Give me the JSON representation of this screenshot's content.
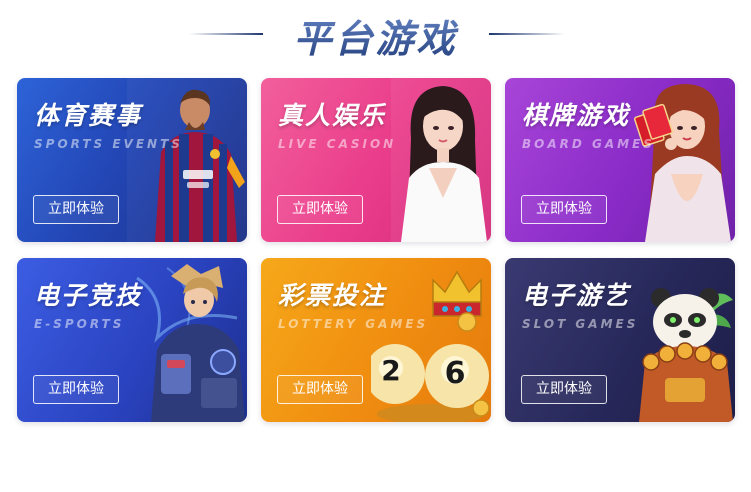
{
  "header": {
    "title": "平台游戏"
  },
  "cards": [
    {
      "title": "体育赛事",
      "subtitle": "SPORTS EVENTS",
      "button": "立即体验"
    },
    {
      "title": "真人娱乐",
      "subtitle": "LIVE CASION",
      "button": "立即体验"
    },
    {
      "title": "棋牌游戏",
      "subtitle": "BOARD GAMES",
      "button": "立即体验"
    },
    {
      "title": "电子竞技",
      "subtitle": "E-SPORTS",
      "button": "立即体验"
    },
    {
      "title": "彩票投注",
      "subtitle": "LOTTERY GAMES",
      "button": "立即体验"
    },
    {
      "title": "电子游艺",
      "subtitle": "SLOT GAMES",
      "button": "立即体验"
    }
  ],
  "lottery_balls": [
    "2",
    "6"
  ],
  "colors": {
    "header_title": "#2c4784",
    "sports": "#2346b5",
    "live": "#ea3d8b",
    "board": "#8a2bc8",
    "esports": "#2a43c0",
    "lottery": "#f08d10",
    "slot": "#27285a"
  },
  "icons": [
    "soccer-player-illustration",
    "live-dealer-illustration",
    "card-dealer-illustration",
    "esports-hero-illustration",
    "lottery-balls-illustration",
    "panda-slot-illustration"
  ]
}
